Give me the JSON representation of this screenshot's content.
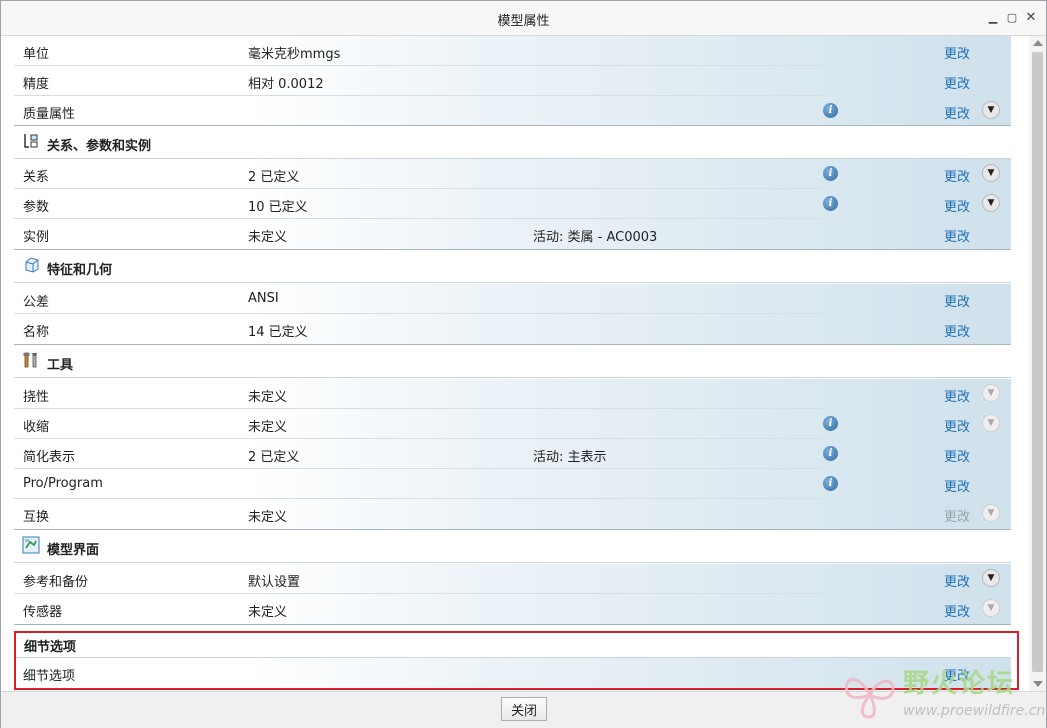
{
  "window": {
    "title": "模型属性"
  },
  "rows_top": [
    {
      "label": "单位",
      "value": "毫米克秒mmgs",
      "change": "更改"
    },
    {
      "label": "精度",
      "value": "相对 0.0012",
      "change": "更改"
    },
    {
      "label": "质量属性",
      "value": "",
      "change": "更改"
    }
  ],
  "sections": [
    {
      "title": "关系、参数和实例",
      "icon": "relations-icon",
      "rows": [
        {
          "label": "关系",
          "value": "2 已定义",
          "change": "更改"
        },
        {
          "label": "参数",
          "value": "10 已定义",
          "change": "更改"
        },
        {
          "label": "实例",
          "value": "未定义",
          "extra": "活动: 类属 - AC0003",
          "change": "更改"
        }
      ]
    },
    {
      "title": "特征和几何",
      "icon": "feature-geometry-icon",
      "rows": [
        {
          "label": "公差",
          "value": "ANSI",
          "change": "更改"
        },
        {
          "label": "名称",
          "value": "14 已定义",
          "change": "更改"
        }
      ]
    },
    {
      "title": "工具",
      "icon": "tools-icon",
      "rows": [
        {
          "label": "挠性",
          "value": "未定义",
          "change": "更改"
        },
        {
          "label": "收缩",
          "value": "未定义",
          "change": "更改"
        },
        {
          "label": "简化表示",
          "value": "2 已定义",
          "extra": "活动: 主表示",
          "change": "更改"
        },
        {
          "label": "Pro/Program",
          "value": "",
          "change": "更改"
        },
        {
          "label": "互换",
          "value": "未定义",
          "change": "更改"
        }
      ]
    },
    {
      "title": "模型界面",
      "icon": "model-interface-icon",
      "rows": [
        {
          "label": "参考和备份",
          "value": "默认设置",
          "change": "更改"
        },
        {
          "label": "传感器",
          "value": "未定义",
          "change": "更改"
        }
      ]
    },
    {
      "title": "细节选项",
      "rows": [
        {
          "label": "细节选项",
          "value": "",
          "change": "更改"
        }
      ]
    }
  ],
  "footer": {
    "close_label": "关闭"
  },
  "watermark": {
    "text": "野火论坛",
    "url": "www.proewildfire.cn"
  },
  "colors": {
    "link": "#1e6fb8",
    "highlight_border": "#d9202a"
  }
}
